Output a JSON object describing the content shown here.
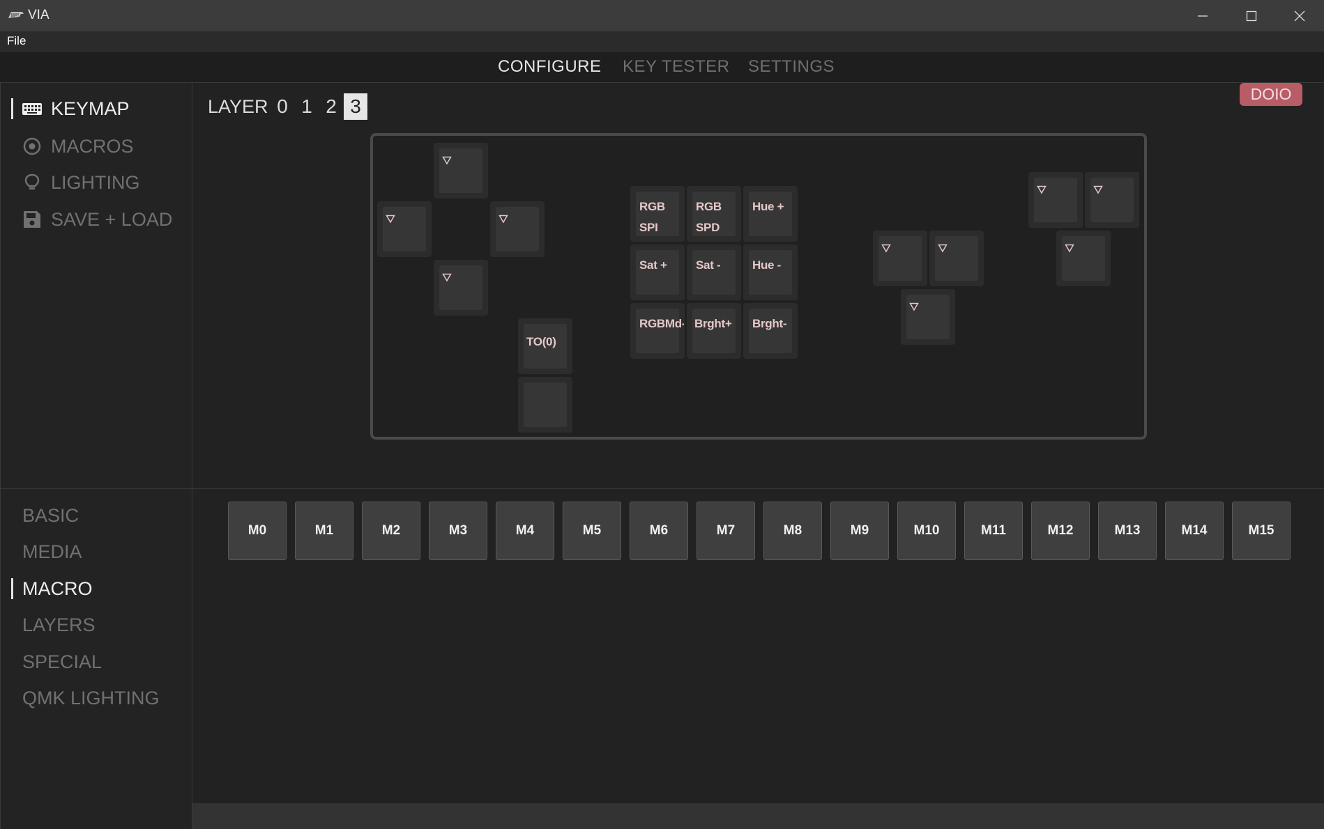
{
  "window": {
    "title": "VIA",
    "logo_icon": "via-logo-icon",
    "controls": [
      "minimize-icon",
      "maximize-icon",
      "close-icon"
    ]
  },
  "menubar": {
    "file": "File"
  },
  "nav": {
    "tabs": [
      {
        "label": "CONFIGURE",
        "active": true
      },
      {
        "label": "KEY TESTER",
        "active": false
      },
      {
        "label": "SETTINGS",
        "active": false
      }
    ]
  },
  "sidebar": {
    "items": [
      {
        "label": "KEYMAP",
        "icon": "keyboard-icon",
        "active": true
      },
      {
        "label": "MACROS",
        "icon": "record-icon",
        "active": false
      },
      {
        "label": "LIGHTING",
        "icon": "lightbulb-icon",
        "active": false
      },
      {
        "label": "SAVE + LOAD",
        "icon": "floppy-disk-icon",
        "active": false
      }
    ]
  },
  "layers": {
    "label": "LAYER",
    "options": [
      "0",
      "1",
      "2",
      "3"
    ],
    "selected": "3"
  },
  "brand": {
    "badge": "DOIO"
  },
  "keyboard": {
    "keys": {
      "rgb_spi": "RGB\nSPI",
      "rgb_spd": "RGB\nSPD",
      "hue_up": "Hue +",
      "sat_up": "Sat +",
      "sat_down": "Sat -",
      "hue_down": "Hue -",
      "rgb_mode": "RGBMd-",
      "bright_up": "Brght+",
      "bright_down": "Brght-",
      "to0": "TO(0)"
    },
    "transparent_icon": "transparent-triangle-icon"
  },
  "categories": {
    "items": [
      {
        "label": "BASIC",
        "active": false
      },
      {
        "label": "MEDIA",
        "active": false
      },
      {
        "label": "MACRO",
        "active": true
      },
      {
        "label": "LAYERS",
        "active": false
      },
      {
        "label": "SPECIAL",
        "active": false
      },
      {
        "label": "QMK LIGHTING",
        "active": false
      }
    ]
  },
  "macros": {
    "keys": [
      "M0",
      "M1",
      "M2",
      "M3",
      "M4",
      "M5",
      "M6",
      "M7",
      "M8",
      "M9",
      "M10",
      "M11",
      "M12",
      "M13",
      "M14",
      "M15"
    ]
  },
  "colors": {
    "accent_badge": "#b85c66",
    "key_legend": "#e6c8c8",
    "background": "#222222"
  }
}
